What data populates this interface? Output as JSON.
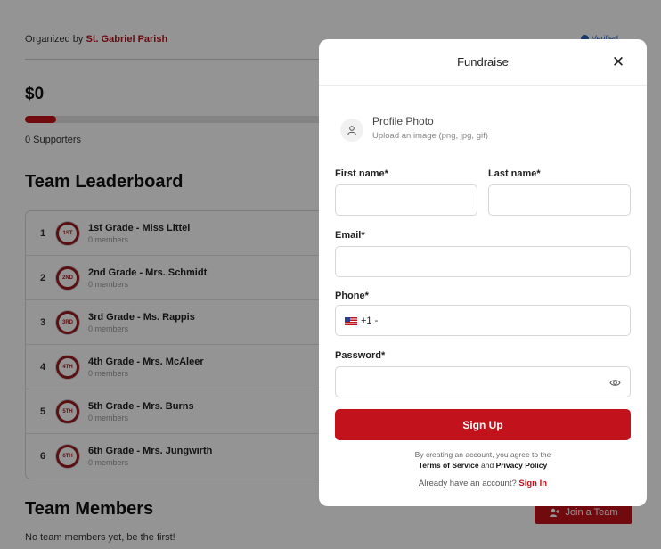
{
  "page": {
    "organized_prefix": "Organized by",
    "organizer": "St. Gabriel Parish",
    "verified_label": "Verified",
    "amount_raised": "$0",
    "progress_fraction": 0.05,
    "supporters": "0 Supporters",
    "leaderboard_title": "Team Leaderboard",
    "leaderboard": [
      {
        "rank": "1",
        "badge": "1ST",
        "name": "1st Grade - Miss Littel",
        "members": "0 members"
      },
      {
        "rank": "2",
        "badge": "2ND",
        "name": "2nd Grade - Mrs. Schmidt",
        "members": "0 members"
      },
      {
        "rank": "3",
        "badge": "3RD",
        "name": "3rd Grade - Ms. Rappis",
        "members": "0 members"
      },
      {
        "rank": "4",
        "badge": "4TH",
        "name": "4th Grade - Mrs. McAleer",
        "members": "0 members"
      },
      {
        "rank": "5",
        "badge": "5TH",
        "name": "5th Grade - Mrs. Burns",
        "members": "0 members"
      },
      {
        "rank": "6",
        "badge": "6TH",
        "name": "6th Grade - Mrs. Jungwirth",
        "members": "0 members"
      }
    ],
    "team_members_title": "Team Members",
    "join_team_label": "Join a Team",
    "team_members_empty": "No team members yet, be the first!"
  },
  "modal": {
    "title": "Fundraise",
    "close_icon": "close-icon",
    "profile_photo_title": "Profile Photo",
    "profile_photo_sub": "Upload an image (png, jpg, gif)",
    "first_name_label": "First name*",
    "first_name_value": "",
    "last_name_label": "Last name*",
    "last_name_value": "",
    "email_label": "Email*",
    "email_value": "",
    "phone_label": "Phone*",
    "phone_prefix": "+1 -",
    "phone_value": "",
    "password_label": "Password*",
    "password_value": "",
    "signup_label": "Sign Up",
    "terms_line1": "By creating an account, you agree to the",
    "terms_of_service": "Terms of Service",
    "terms_and": "and",
    "privacy_policy": "Privacy Policy",
    "have_account": "Already have an account?",
    "signin_label": "Sign In"
  },
  "colors": {
    "brand_red": "#c2121b",
    "overlay": "rgba(0,0,0,0.42)"
  }
}
